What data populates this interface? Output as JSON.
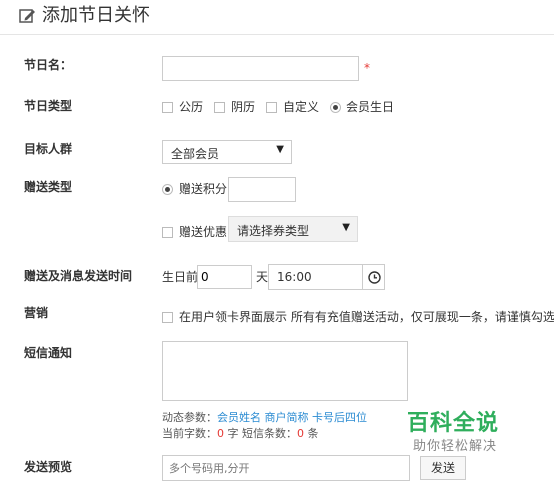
{
  "header": {
    "title": "添加节日关怀",
    "icon": "edit-icon"
  },
  "form": {
    "holiday_name": {
      "label": "节日名：",
      "value": "",
      "required_mark": "*"
    },
    "holiday_type": {
      "label": "节日类型",
      "options": [
        "公历",
        "阴历",
        "自定义",
        "会员生日"
      ],
      "selected": "会员生日"
    },
    "target_group": {
      "label": "目标人群",
      "selected": "全部会员"
    },
    "gift_type": {
      "label": "赠送类型",
      "points_label": "赠送积分",
      "points_value": "",
      "coupon_label": "赠送优惠",
      "coupon_select": "请选择券类型"
    },
    "send_time": {
      "label": "赠送及消息发送时间",
      "prefix": "生日前",
      "days_value": "0",
      "days_unit": "天",
      "time_value": "16:00",
      "clock_icon": "clock-icon"
    },
    "marketing": {
      "label": "营销",
      "text": "在用户领卡界面展示 所有有充值赠送活动，仅可展现一条，请谨慎勾选"
    },
    "sms": {
      "label": "短信通知",
      "value": "",
      "dynamic_params_label": "动态参数：",
      "params": [
        "会员姓名",
        "商户简称",
        "卡号后四位"
      ],
      "char_count_label": "当前字数：",
      "char_count": "0",
      "char_unit": "字",
      "sms_count_label": "短信条数：",
      "sms_count": "0",
      "sms_unit": "条"
    },
    "preview": {
      "label": "发送预览",
      "placeholder": "多个号码用,分开",
      "send_button": "发送"
    }
  },
  "watermark": {
    "main": "百科全说",
    "sub": "助你轻松解决"
  },
  "colors": {
    "required": "#e53935",
    "link": "#2a8bd2",
    "watermark": "#2fae5c"
  }
}
